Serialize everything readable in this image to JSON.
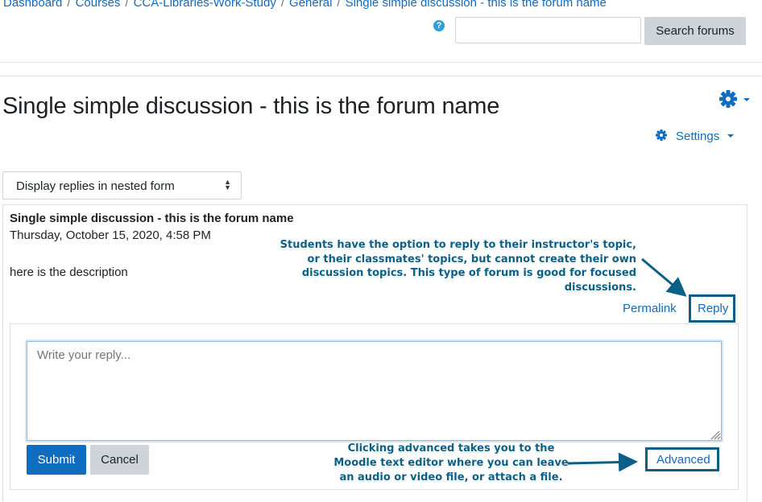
{
  "breadcrumb": {
    "items": [
      "Dashboard",
      "Courses",
      "CCA-Libraries-Work-Study",
      "General",
      "Single simple discussion - this is the forum name"
    ],
    "separator": "/"
  },
  "search": {
    "value": "",
    "placeholder": "",
    "button_label": "Search forums",
    "help_icon": "question-circle-icon"
  },
  "page": {
    "title": "Single simple discussion - this is the forum name",
    "settings_label": "Settings",
    "settings_icon": "gear-icon"
  },
  "display_mode": {
    "selected": "Display replies in nested form"
  },
  "post": {
    "subject": "Single simple discussion - this is the forum name",
    "date": "Thursday, October 15, 2020, 4:58 PM",
    "message": "here is the description",
    "permalink_label": "Permalink",
    "reply_label": "Reply"
  },
  "reply_form": {
    "placeholder": "Write your reply...",
    "submit_label": "Submit",
    "cancel_label": "Cancel",
    "advanced_label": "Advanced"
  },
  "annotations": {
    "reply_note": [
      "Students have the option to reply to their instructor's topic,",
      "or their classmates' topics, but cannot create their own",
      "discussion topics. This type of forum is good for focused discussions."
    ],
    "advanced_note": [
      "Clicking advanced takes you to the",
      "Moodle text editor where you can leave",
      "an audio or video file, or attach a file."
    ]
  },
  "colors": {
    "link": "#0f6cbf",
    "primary_button": "#0f6cbf",
    "secondary_button": "#ced4da",
    "annotation": "#0c5f86"
  }
}
